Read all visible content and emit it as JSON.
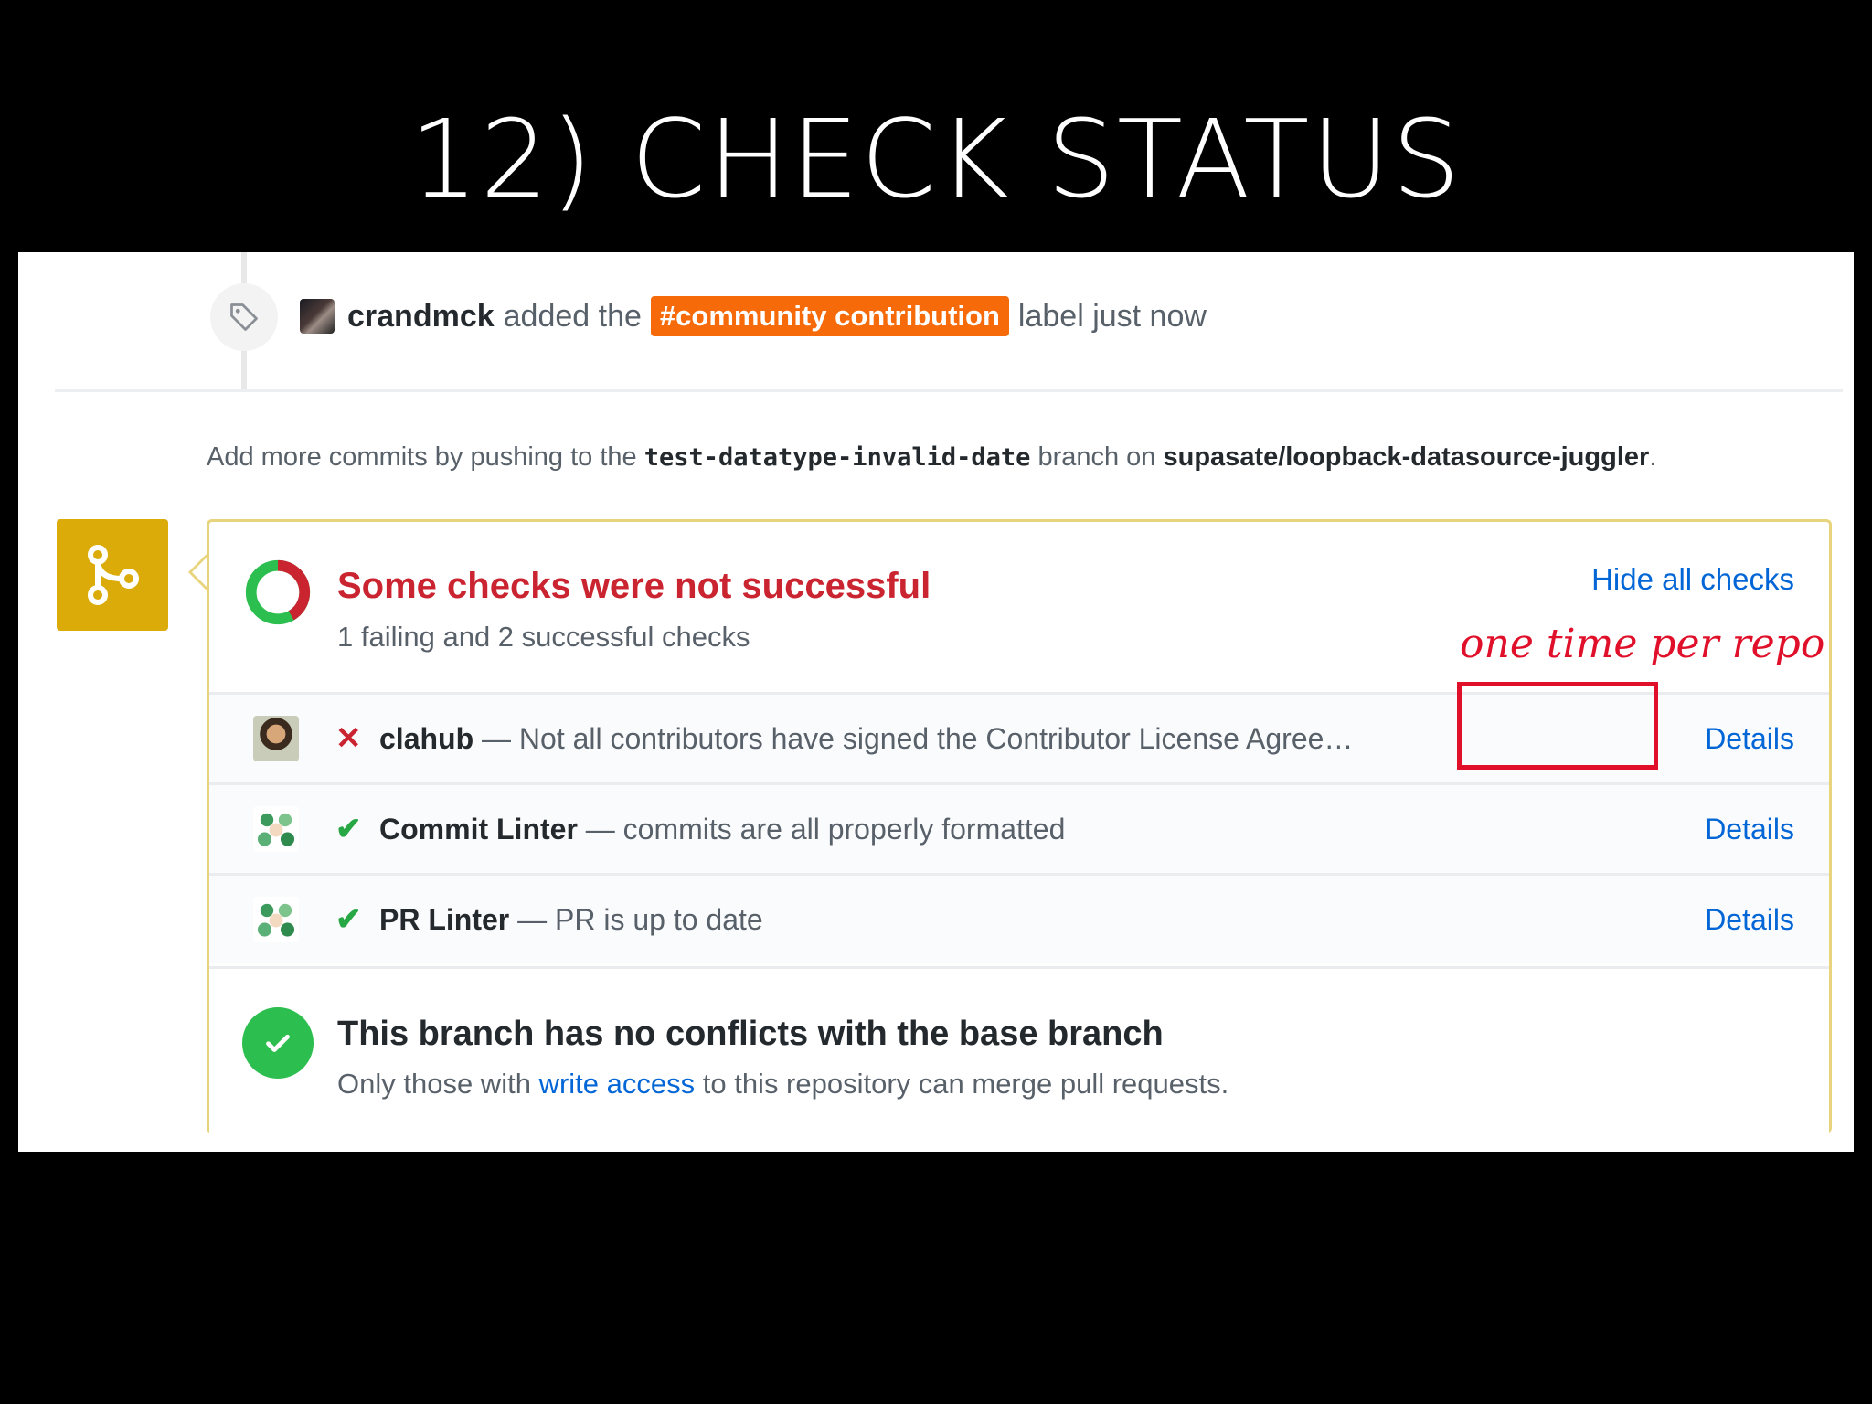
{
  "slide": {
    "title": "12) CHECK STATUS"
  },
  "event": {
    "user": "crandmck",
    "action": "added the",
    "label": "#community contribution",
    "suffix": "label just now"
  },
  "commits_note": {
    "prefix": "Add more commits by pushing to the",
    "branch": "test-datatype-invalid-date",
    "middle": "branch on",
    "repo": "supasate/loopback-datasource-juggler",
    "end": "."
  },
  "status": {
    "title": "Some checks were not successful",
    "subtitle": "1 failing and 2 successful checks",
    "hide_link": "Hide all checks",
    "failing_count": 1,
    "successful_count": 2,
    "colors": {
      "failing": "#cb2431",
      "success": "#2cbe4e"
    }
  },
  "annotation": "one time per repo",
  "checks": [
    {
      "name": "clahub",
      "status": "failure",
      "icon": "x-icon",
      "description": "— Not all contributors have signed the Contributor License Agree…",
      "details": "Details"
    },
    {
      "name": "Commit Linter",
      "status": "success",
      "icon": "check-icon",
      "description": "— commits are all properly formatted",
      "details": "Details"
    },
    {
      "name": "PR Linter",
      "status": "success",
      "icon": "check-icon",
      "description": "— PR is up to date",
      "details": "Details"
    }
  ],
  "merge": {
    "title": "This branch has no conflicts with the base branch",
    "sub_prefix": "Only those with",
    "sub_link": "write access",
    "sub_suffix": "to this repository can merge pull requests."
  }
}
